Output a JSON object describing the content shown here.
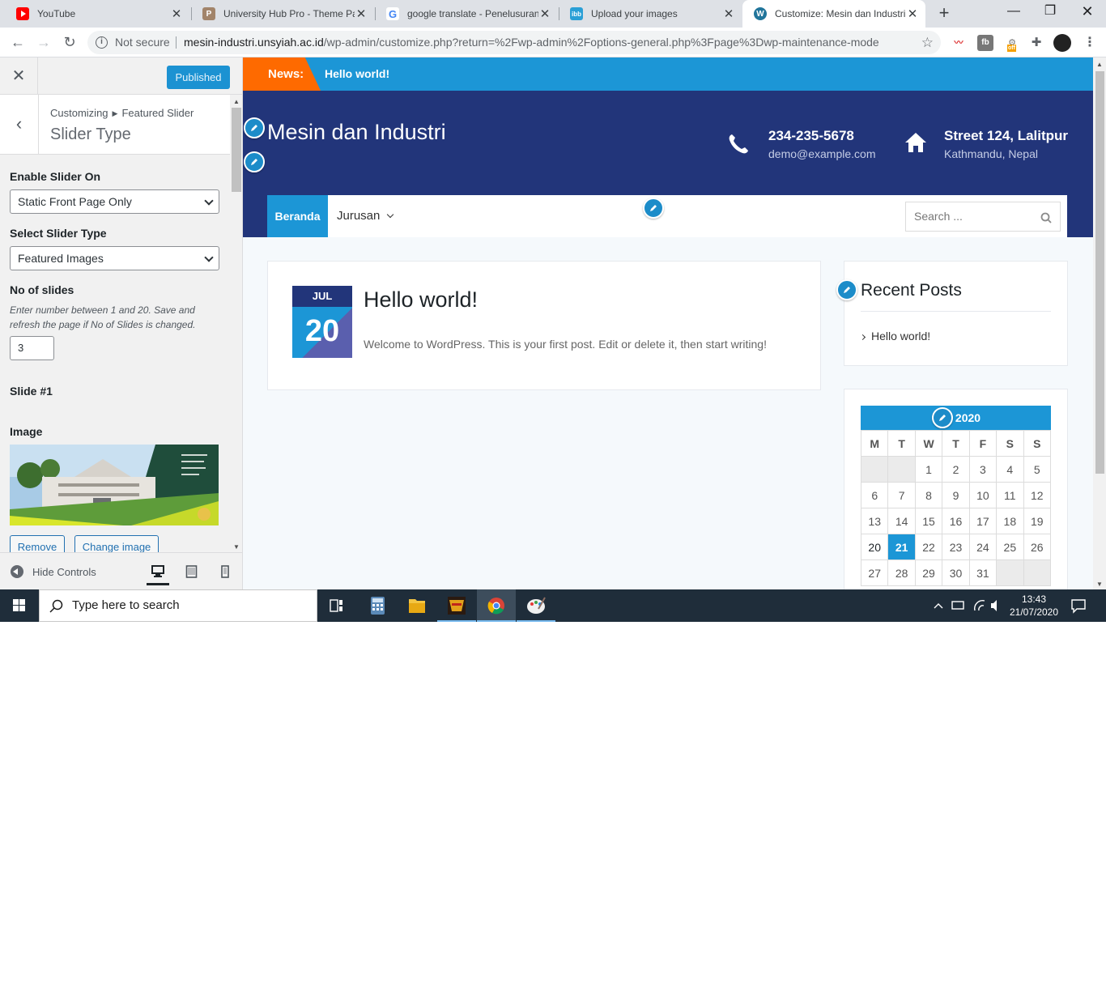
{
  "browser": {
    "tabs": [
      {
        "title": "YouTube",
        "icon": "youtube-icon",
        "color": "#ff0000"
      },
      {
        "title": "University Hub Pro - Theme Pa",
        "icon": "theme-p-icon",
        "color": "#a2846a"
      },
      {
        "title": "google translate - Penelusuran",
        "icon": "google-icon",
        "color": "#4285f4"
      },
      {
        "title": "Upload your images",
        "icon": "imgbb-icon",
        "color": "#2a9fd6"
      },
      {
        "title": "Customize: Mesin dan Industri",
        "icon": "wordpress-icon",
        "color": "#21759b"
      }
    ],
    "not_secure": "Not secure",
    "url_host": "mesin-industri.unsyiah.ac.id",
    "url_path": "/wp-admin/customize.php?return=%2Fwp-admin%2Foptions-general.php%3Fpage%3Dwp-maintenance-mode"
  },
  "customizer": {
    "published_label": "Published",
    "breadcrumb_root": "Customizing",
    "breadcrumb_section": "Featured Slider",
    "section_title": "Slider Type",
    "enable_label": "Enable Slider On",
    "enable_value": "Static Front Page Only",
    "type_label": "Select Slider Type",
    "type_value": "Featured Images",
    "slides_label": "No of slides",
    "slides_desc": "Enter number between 1 and 20. Save and refresh the page if No of Slides is changed.",
    "slides_value": "3",
    "slide_heading": "Slide #1",
    "image_label": "Image",
    "remove_label": "Remove",
    "change_label": "Change image",
    "hide_controls": "Hide Controls"
  },
  "site": {
    "news_label": "News:",
    "news_text": "Hello world!",
    "title": "Mesin dan Industri",
    "phone": "234-235-5678",
    "email": "demo@example.com",
    "address": "Street 124, Lalitpur",
    "city": "Kathmandu, Nepal",
    "menu": {
      "home": "Beranda",
      "jurusan": "Jurusan"
    },
    "search_placeholder": "Search ...",
    "post": {
      "month": "JUL",
      "day": "20",
      "title": "Hello world!",
      "excerpt": "Welcome to WordPress. This is your first post. Edit or delete it, then start writing!"
    },
    "recent_title": "Recent Posts",
    "recent_item": "Hello world!",
    "calendar": {
      "caption": "2020",
      "days": [
        "M",
        "T",
        "W",
        "T",
        "F",
        "S",
        "S"
      ],
      "weeks": [
        [
          "",
          "",
          "1",
          "2",
          "3",
          "4",
          "5"
        ],
        [
          "6",
          "7",
          "8",
          "9",
          "10",
          "11",
          "12"
        ],
        [
          "13",
          "14",
          "15",
          "16",
          "17",
          "18",
          "19"
        ],
        [
          "20",
          "21",
          "22",
          "23",
          "24",
          "25",
          "26"
        ],
        [
          "27",
          "28",
          "29",
          "30",
          "31",
          "",
          ""
        ]
      ],
      "today": "21",
      "linked": "20"
    },
    "colors": {
      "accent": "#1c96d6",
      "header": "#22357a",
      "news": "#fe6a00"
    }
  },
  "taskbar": {
    "search_placeholder": "Type here to search",
    "time": "13:43",
    "date": "21/07/2020"
  }
}
